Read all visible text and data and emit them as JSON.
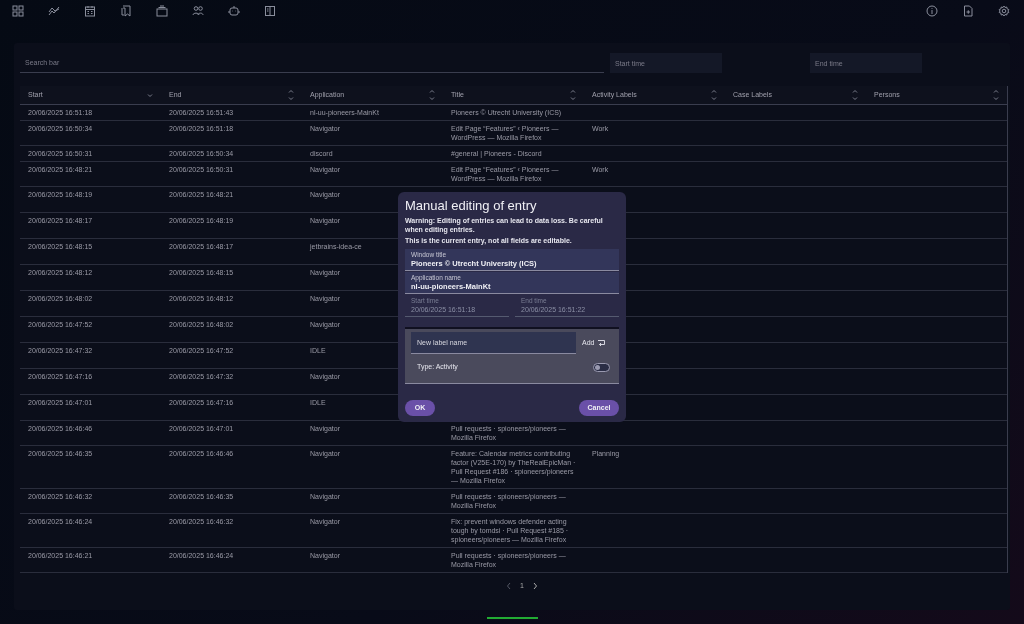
{
  "search": {
    "placeholder": "Search bar"
  },
  "start_time": {
    "placeholder": "Start time"
  },
  "end_time": {
    "placeholder": "End time"
  },
  "table": {
    "columns": [
      {
        "label": "Start",
        "sorted": true
      },
      {
        "label": "End",
        "sorted": false
      },
      {
        "label": "Application",
        "sorted": false
      },
      {
        "label": "Title",
        "sorted": false
      },
      {
        "label": "Activity Labels",
        "sorted": false
      },
      {
        "label": "Case Labels",
        "sorted": false
      },
      {
        "label": "Persons",
        "sorted": false
      }
    ],
    "rows": [
      {
        "start": "20/06/2025 16:51:18",
        "end": "20/06/2025 16:51:43",
        "application": "nl-uu-pioneers-MainKt",
        "title": "Pioneers © Utrecht University (ICS)"
      },
      {
        "start": "20/06/2025 16:50:34",
        "end": "20/06/2025 16:51:18",
        "application": "Navigator",
        "title": "Edit Page “Features” ‹ Pioneers — WordPress — Mozilla Firefox",
        "activity_labels": "Work"
      },
      {
        "start": "20/06/2025 16:50:31",
        "end": "20/06/2025 16:50:34",
        "application": "discord",
        "title": "#general | Pioneers - Discord"
      },
      {
        "start": "20/06/2025 16:48:21",
        "end": "20/06/2025 16:50:31",
        "application": "Navigator",
        "title": "Edit Page “Features” ‹ Pioneers — WordPress — Mozilla Firefox",
        "activity_labels": "Work"
      },
      {
        "start": "20/06/2025 16:48:19",
        "end": "20/06/2025 16:48:21",
        "application": "Navigator"
      },
      {
        "start": "20/06/2025 16:48:17",
        "end": "20/06/2025 16:48:19",
        "application": "Navigator"
      },
      {
        "start": "20/06/2025 16:48:15",
        "end": "20/06/2025 16:48:17",
        "application": "jetbrains-idea-ce"
      },
      {
        "start": "20/06/2025 16:48:12",
        "end": "20/06/2025 16:48:15",
        "application": "Navigator"
      },
      {
        "start": "20/06/2025 16:48:02",
        "end": "20/06/2025 16:48:12",
        "application": "Navigator"
      },
      {
        "start": "20/06/2025 16:47:52",
        "end": "20/06/2025 16:48:02",
        "application": "Navigator"
      },
      {
        "start": "20/06/2025 16:47:32",
        "end": "20/06/2025 16:47:52",
        "application": "IDLE"
      },
      {
        "start": "20/06/2025 16:47:16",
        "end": "20/06/2025 16:47:32",
        "application": "Navigator"
      },
      {
        "start": "20/06/2025 16:47:01",
        "end": "20/06/2025 16:47:16",
        "application": "IDLE"
      },
      {
        "start": "20/06/2025 16:46:46",
        "end": "20/06/2025 16:47:01",
        "application": "Navigator",
        "title": "Pull requests · spioneers/pioneers — Mozilla Firefox"
      },
      {
        "start": "20/06/2025 16:46:35",
        "end": "20/06/2025 16:46:46",
        "application": "Navigator",
        "title": "Feature: Calendar metrics contributing factor (V25E-170) by TheRealEpicMan · Pull Request #186 · spioneers/pioneers — Mozilla Firefox",
        "activity_labels": "Planning"
      },
      {
        "start": "20/06/2025 16:46:32",
        "end": "20/06/2025 16:46:35",
        "application": "Navigator",
        "title": "Pull requests · spioneers/pioneers — Mozilla Firefox"
      },
      {
        "start": "20/06/2025 16:46:24",
        "end": "20/06/2025 16:46:32",
        "application": "Navigator",
        "title": "Fix: prevent windows defender acting tough by tomdsi · Pull Request #185 · spioneers/pioneers — Mozilla Firefox"
      },
      {
        "start": "20/06/2025 16:46:21",
        "end": "20/06/2025 16:46:24",
        "application": "Navigator",
        "title": "Pull requests · spioneers/pioneers — Mozilla Firefox"
      }
    ]
  },
  "pagination": {
    "page": "1"
  },
  "dialog": {
    "title": "Manual editing of entry",
    "warning": "Warning: Editing of entries can lead to data loss. Be careful when editing entries.",
    "note": "This is the current entry, not all fields are editable.",
    "window_title": {
      "label": "Window title",
      "value": "Pioneers © Utrecht University (ICS)"
    },
    "application_name": {
      "label": "Application name",
      "value": "nl-uu-pioneers-MainKt"
    },
    "start_time": {
      "label": "Start time",
      "value": "20/06/2025 16:51:18",
      "disabled": true
    },
    "end_time": {
      "label": "End time",
      "value": "20/06/2025 16:51:22",
      "disabled": true
    },
    "label_input": {
      "placeholder": "New label name"
    },
    "add_button": "Add",
    "type_toggle": {
      "label": "Type: Activity",
      "on": false
    },
    "ok_button": "OK",
    "cancel_button": "Cancel"
  }
}
